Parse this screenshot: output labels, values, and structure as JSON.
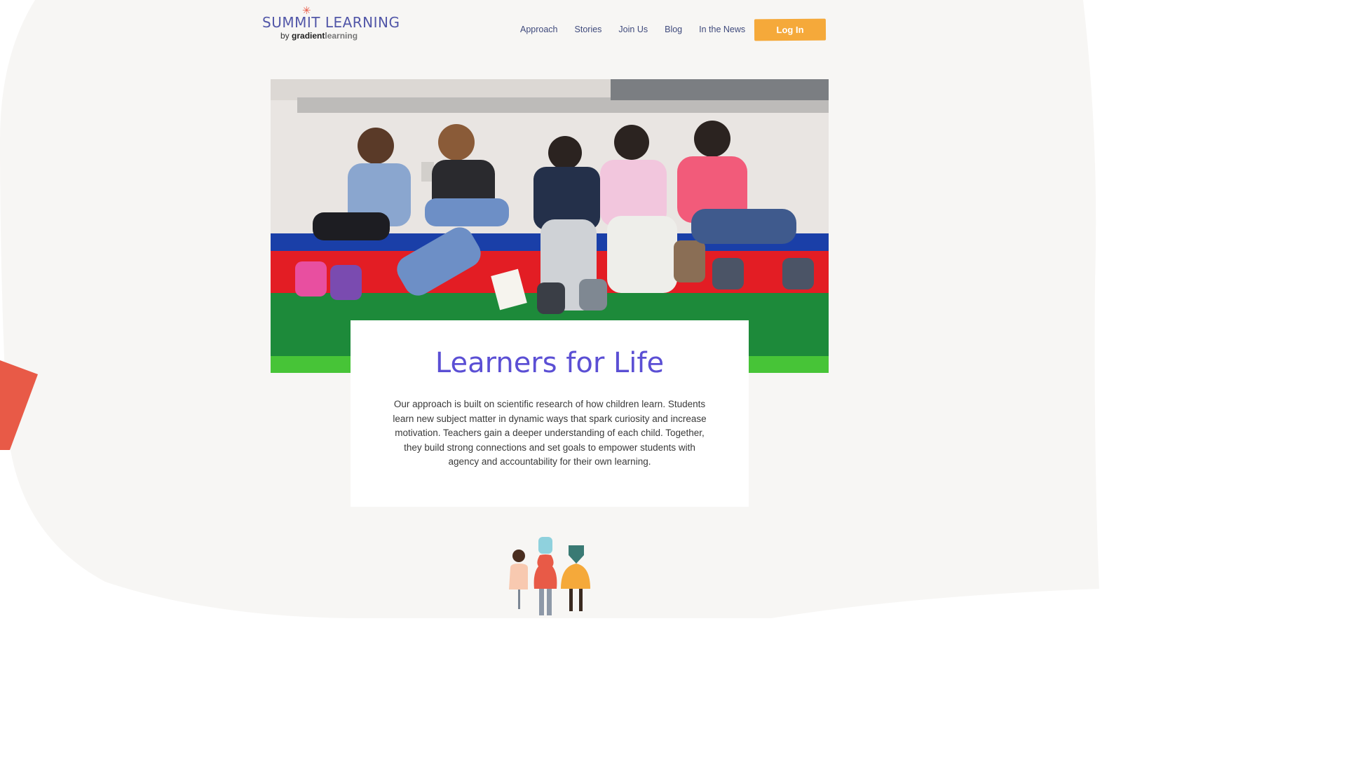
{
  "header": {
    "logo_main": "SUMMIT LEARNING",
    "logo_by": "by",
    "logo_brand_bold": "gradient",
    "logo_brand_light": "learning",
    "nav": [
      "Approach",
      "Stories",
      "Join Us",
      "Blog",
      "In the News"
    ],
    "login_label": "Log In"
  },
  "main": {
    "title": "Learners for Life",
    "body": "Our approach is built on scientific research of how children learn. Students learn new subject matter in dynamic ways that spark curiosity and increase motivation. Teachers gain a deeper understanding of each child. Together, they build strong connections and set goals to empower students with agency and accountability for their own learning."
  },
  "colors": {
    "accent_purple": "#5b4fd4",
    "nav_text": "#3f4a7c",
    "button": "#f5a93a",
    "coral": "#e85a47",
    "background": "#f7f6f4"
  },
  "icons": [
    "asterisk-star-icon",
    "people-figures-icon"
  ]
}
